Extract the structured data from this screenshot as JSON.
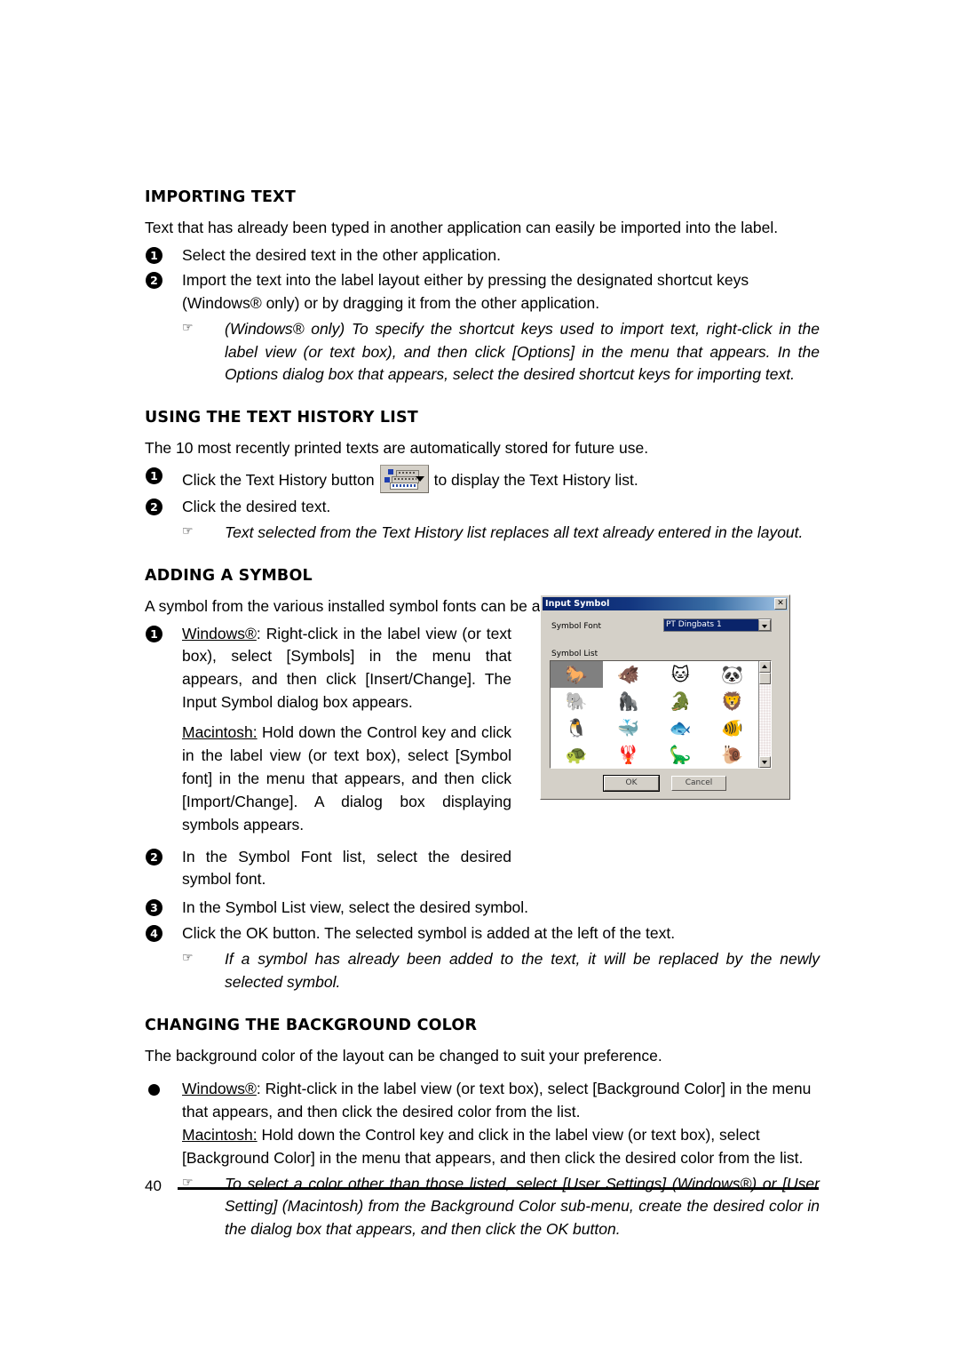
{
  "page": {
    "number": "40"
  },
  "sections": [
    {
      "heading": "IMPORTING TEXT",
      "intro": "Text that has already been typed in another application can easily be imported into the label.",
      "steps": [
        {
          "marker": "1",
          "text": "Select the desired text in the other application."
        },
        {
          "marker": "2",
          "text": "Import the text into the label layout either by pressing the designated shortcut keys (Windows® only) or by dragging it from the other application."
        }
      ],
      "note": "(Windows® only) To specify the shortcut keys used to import text, right-click in the label view (or text box), and then click [Options] in the menu that appears. In the Options dialog box that appears, select the desired shortcut keys for importing text."
    },
    {
      "heading": "USING THE TEXT HISTORY LIST",
      "intro": "The 10 most recently printed texts are automatically stored for future use.",
      "steps": [
        {
          "marker": "1",
          "text_before": "Click the Text History button",
          "text_after": "to display the Text History list."
        },
        {
          "marker": "2",
          "text": "Click the desired text."
        }
      ],
      "note": "Text selected from the Text History list replaces all text already entered in the layout."
    },
    {
      "heading": "ADDING A SYMBOL",
      "intro": "A symbol from the various installed symbol fonts can be added at the left side of the label text.",
      "steps": [
        {
          "marker": "1",
          "windows_label": "Windows®",
          "windows_text": ": Right-click in the label view (or text box), select [Symbols] in the menu that appears, and then click [Insert/Change]. The Input Symbol dialog box appears.",
          "mac_label": "Macintosh:",
          "mac_text": " Hold down the Control key and click in the label view (or text box), select [Symbol font] in the menu that appears, and then click [Import/Change]. A dialog box displaying symbols appears."
        },
        {
          "marker": "2",
          "text": "In the Symbol Font list, select the desired symbol font."
        },
        {
          "marker": "3",
          "text": "In the Symbol List view, select the desired symbol."
        },
        {
          "marker": "4",
          "text": "Click the OK button. The selected symbol is added at the left of the text."
        }
      ],
      "note": "If a symbol has already been added to the text, it will be replaced by the newly selected symbol."
    },
    {
      "heading": "CHANGING THE BACKGROUND COLOR",
      "intro": "The background color of the layout can be changed to suit your preference.",
      "steps": [
        {
          "marker": "●",
          "windows_label": "Windows®",
          "windows_text": ": Right-click in the label view (or text box), select [Background Color] in the menu that appears, and then click the desired color from the list.",
          "mac_label": "Macintosh:",
          "mac_text": " Hold down the Control key and click in the label view (or text box), select [Background Color] in the menu that appears, and then click the desired color from the list."
        }
      ],
      "note": "To select a color other than those listed, select [User Settings] (Windows®) or [User Setting] (Macintosh) from the Background Color sub-menu, create the desired color in the dialog box that appears, and then click the OK button."
    }
  ],
  "dialog": {
    "title": "Input Symbol",
    "close_label": "✕",
    "font_label": "Symbol Font",
    "font_value": "PT Dingbats 1",
    "list_label": "Symbol List",
    "symbols": [
      "🐎",
      "🐗",
      "🐱",
      "🐼",
      "🐘",
      "🦍",
      "🐊",
      "🦁",
      "🐧",
      "🐳",
      "🐟",
      "🐠",
      "🐢",
      "🦞",
      "🦕",
      "🐌"
    ],
    "selected_index": 0,
    "ok_label": "OK",
    "cancel_label": "Cancel",
    "scroll_up": "▲",
    "scroll_down": "▼",
    "title_color": "#0a246a",
    "selection_color": "#808080"
  },
  "note_glyph": "☞"
}
